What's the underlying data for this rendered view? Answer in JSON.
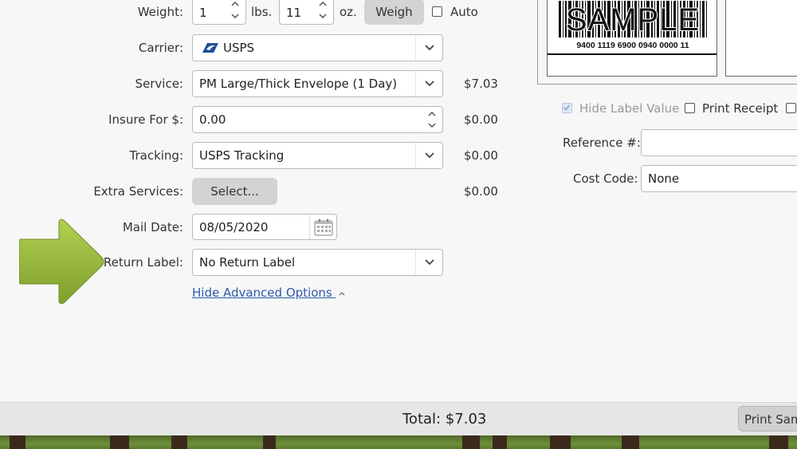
{
  "form": {
    "weight": {
      "label": "Weight:",
      "lbs_value": "1",
      "lbs_unit": "lbs.",
      "oz_value": "11",
      "oz_unit": "oz.",
      "weigh_button": "Weigh",
      "auto_label": "Auto"
    },
    "carrier": {
      "label": "Carrier:",
      "value": "USPS",
      "icon": "usps-eagle-icon"
    },
    "service": {
      "label": "Service:",
      "value": "PM Large/Thick Envelope (1 Day)",
      "price": "$7.03"
    },
    "insure": {
      "label": "Insure For $:",
      "value": "0.00",
      "price": "$0.00"
    },
    "tracking": {
      "label": "Tracking:",
      "value": "USPS Tracking",
      "price": "$0.00"
    },
    "extra_services": {
      "label": "Extra Services:",
      "button": "Select...",
      "price": "$0.00"
    },
    "mail_date": {
      "label": "Mail Date:",
      "value": "08/05/2020"
    },
    "return_label": {
      "label": "Return Label:",
      "value": "No Return Label"
    },
    "advanced_link": "Hide Advanced Options"
  },
  "label_preview": {
    "sample_text": "SAMPLE",
    "tracking_number": "9400 1119 6900 0940 0000 11"
  },
  "options": {
    "hide_label_value": "Hide Label Value",
    "print_receipt": "Print Receipt",
    "reference_label": "Reference #:",
    "reference_value": "",
    "cost_code_label": "Cost Code:",
    "cost_code_value": "None"
  },
  "footer": {
    "total": "Total: $7.03",
    "print_button": "Print Sam"
  },
  "colors": {
    "arrow": "#9cbd3e",
    "link": "#2f5aa8",
    "button_grey": "#d3d3d3"
  }
}
